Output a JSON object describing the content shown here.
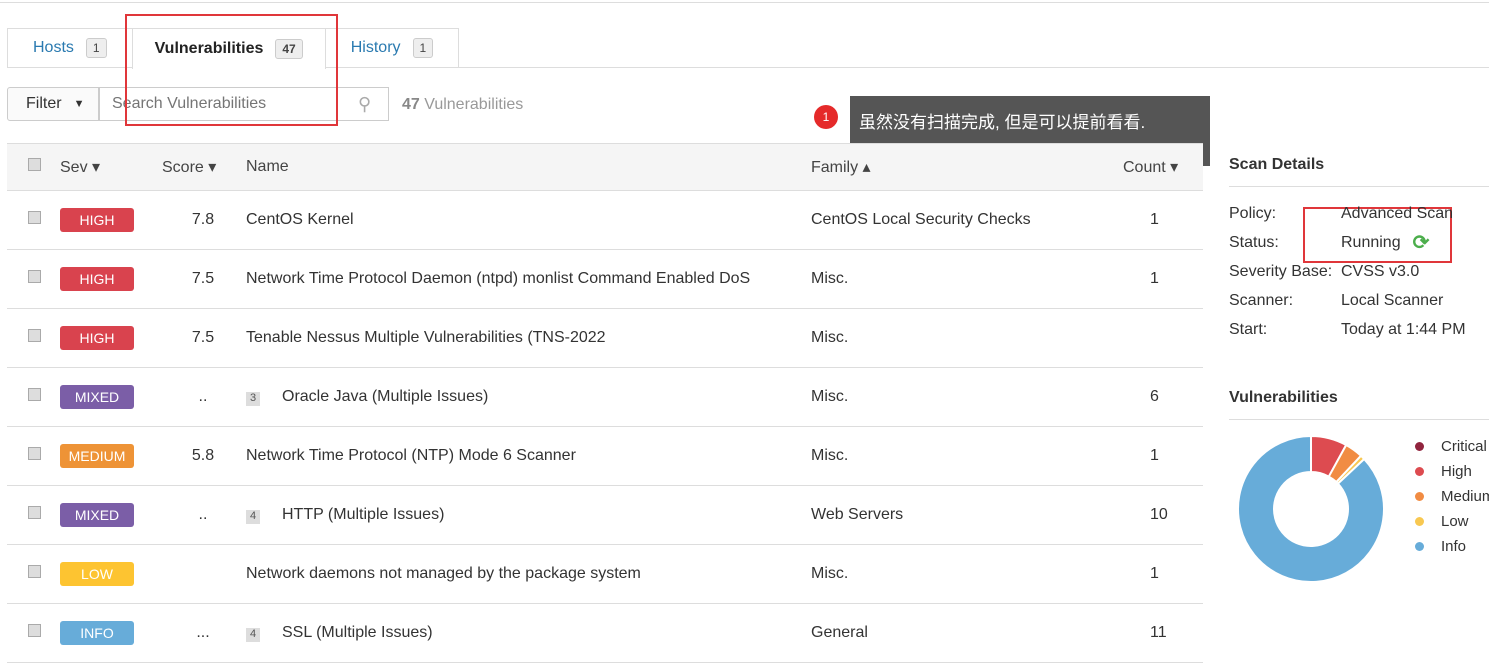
{
  "tabs": [
    {
      "label": "Hosts",
      "count": "1"
    },
    {
      "label": "Vulnerabilities",
      "count": "47",
      "active": true
    },
    {
      "label": "History",
      "count": "1"
    }
  ],
  "toolbar": {
    "filter_label": "Filter",
    "search_placeholder": "Search Vulnerabilities",
    "count": "47",
    "count_label": "Vulnerabilities"
  },
  "annotation": {
    "number": "1",
    "text": "虽然没有扫描完成, 但是可以提前看看."
  },
  "table": {
    "headers": {
      "sev": "Sev ▾",
      "score": "Score ▾",
      "name": "Name",
      "family": "Family ▴",
      "count": "Count ▾"
    },
    "rows": [
      {
        "sev": "HIGH",
        "color": "#d9434e",
        "score": "7.8",
        "group": "",
        "name": "CentOS Kernel",
        "family": "CentOS Local Security Checks",
        "count": "1"
      },
      {
        "sev": "HIGH",
        "color": "#d9434e",
        "score": "7.5",
        "group": "",
        "name": "Network Time Protocol Daemon (ntpd) monlist Command Enabled DoS",
        "family": "Misc.",
        "count": "1"
      },
      {
        "sev": "HIGH",
        "color": "#d9434e",
        "score": "7.5",
        "group": "",
        "name": "Tenable Nessus Multiple Vulnerabilities (TNS-2022",
        "family": "Misc.",
        "count": ""
      },
      {
        "sev": "MIXED",
        "color": "#7b5ea7",
        "score": "..",
        "group": "3",
        "name": "Oracle Java (Multiple Issues)",
        "family": "Misc.",
        "count": "6"
      },
      {
        "sev": "MEDIUM",
        "color": "#ee9336",
        "score": "5.8",
        "group": "",
        "name": "Network Time Protocol (NTP) Mode 6 Scanner",
        "family": "Misc.",
        "count": "1"
      },
      {
        "sev": "MIXED",
        "color": "#7b5ea7",
        "score": "..",
        "group": "4",
        "name": "HTTP (Multiple Issues)",
        "family": "Web Servers",
        "count": "10"
      },
      {
        "sev": "LOW",
        "color": "#fdc431",
        "score": "",
        "group": "",
        "name": "Network daemons not managed by the package system",
        "family": "Misc.",
        "count": "1"
      },
      {
        "sev": "INFO",
        "color": "#67acd9",
        "score": "...",
        "group": "4",
        "name": "SSL (Multiple Issues)",
        "family": "General",
        "count": "11"
      }
    ]
  },
  "scan_details": {
    "title": "Scan Details",
    "rows": [
      {
        "label": "Policy:",
        "value": "Advanced Scan"
      },
      {
        "label": "Status:",
        "value": "Running"
      },
      {
        "label": "Severity Base:",
        "value": "CVSS v3.0"
      },
      {
        "label": "Scanner:",
        "value": "Local Scanner"
      },
      {
        "label": "Start:",
        "value": "Today at 1:44 PM"
      }
    ],
    "status_icon": "refresh-icon",
    "status_icon_color": "#4cae4c"
  },
  "chart_data": {
    "type": "pie",
    "title": "Vulnerabilities",
    "categories": [
      "Critical",
      "High",
      "Medium",
      "Low",
      "Info"
    ],
    "values": [
      0,
      8,
      4,
      1,
      87
    ],
    "colors": [
      "#91243e",
      "#dd4b50",
      "#f18c43",
      "#f8c851",
      "#67acd9"
    ],
    "legend": "right"
  }
}
